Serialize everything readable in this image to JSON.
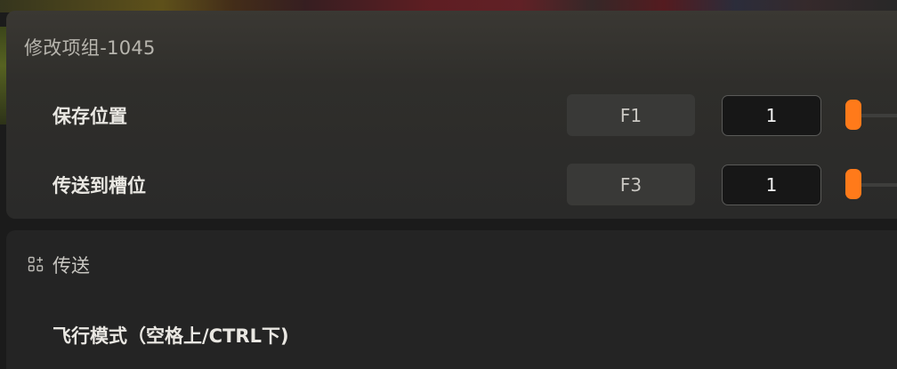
{
  "group": {
    "title": "修改项组-1045",
    "rows": [
      {
        "label": "保存位置",
        "key": "F1",
        "value": "1"
      },
      {
        "label": "传送到槽位",
        "key": "F3",
        "value": "1"
      }
    ]
  },
  "section": {
    "icon": "grid-plus-icon",
    "title": "传送",
    "items": [
      {
        "label": "飞行模式（空格上/CTRL下)"
      }
    ]
  },
  "colors": {
    "accent": "#ff7a1a",
    "panel": "#2f2e2b",
    "input_bg": "#171717",
    "key_bg": "#393937"
  }
}
